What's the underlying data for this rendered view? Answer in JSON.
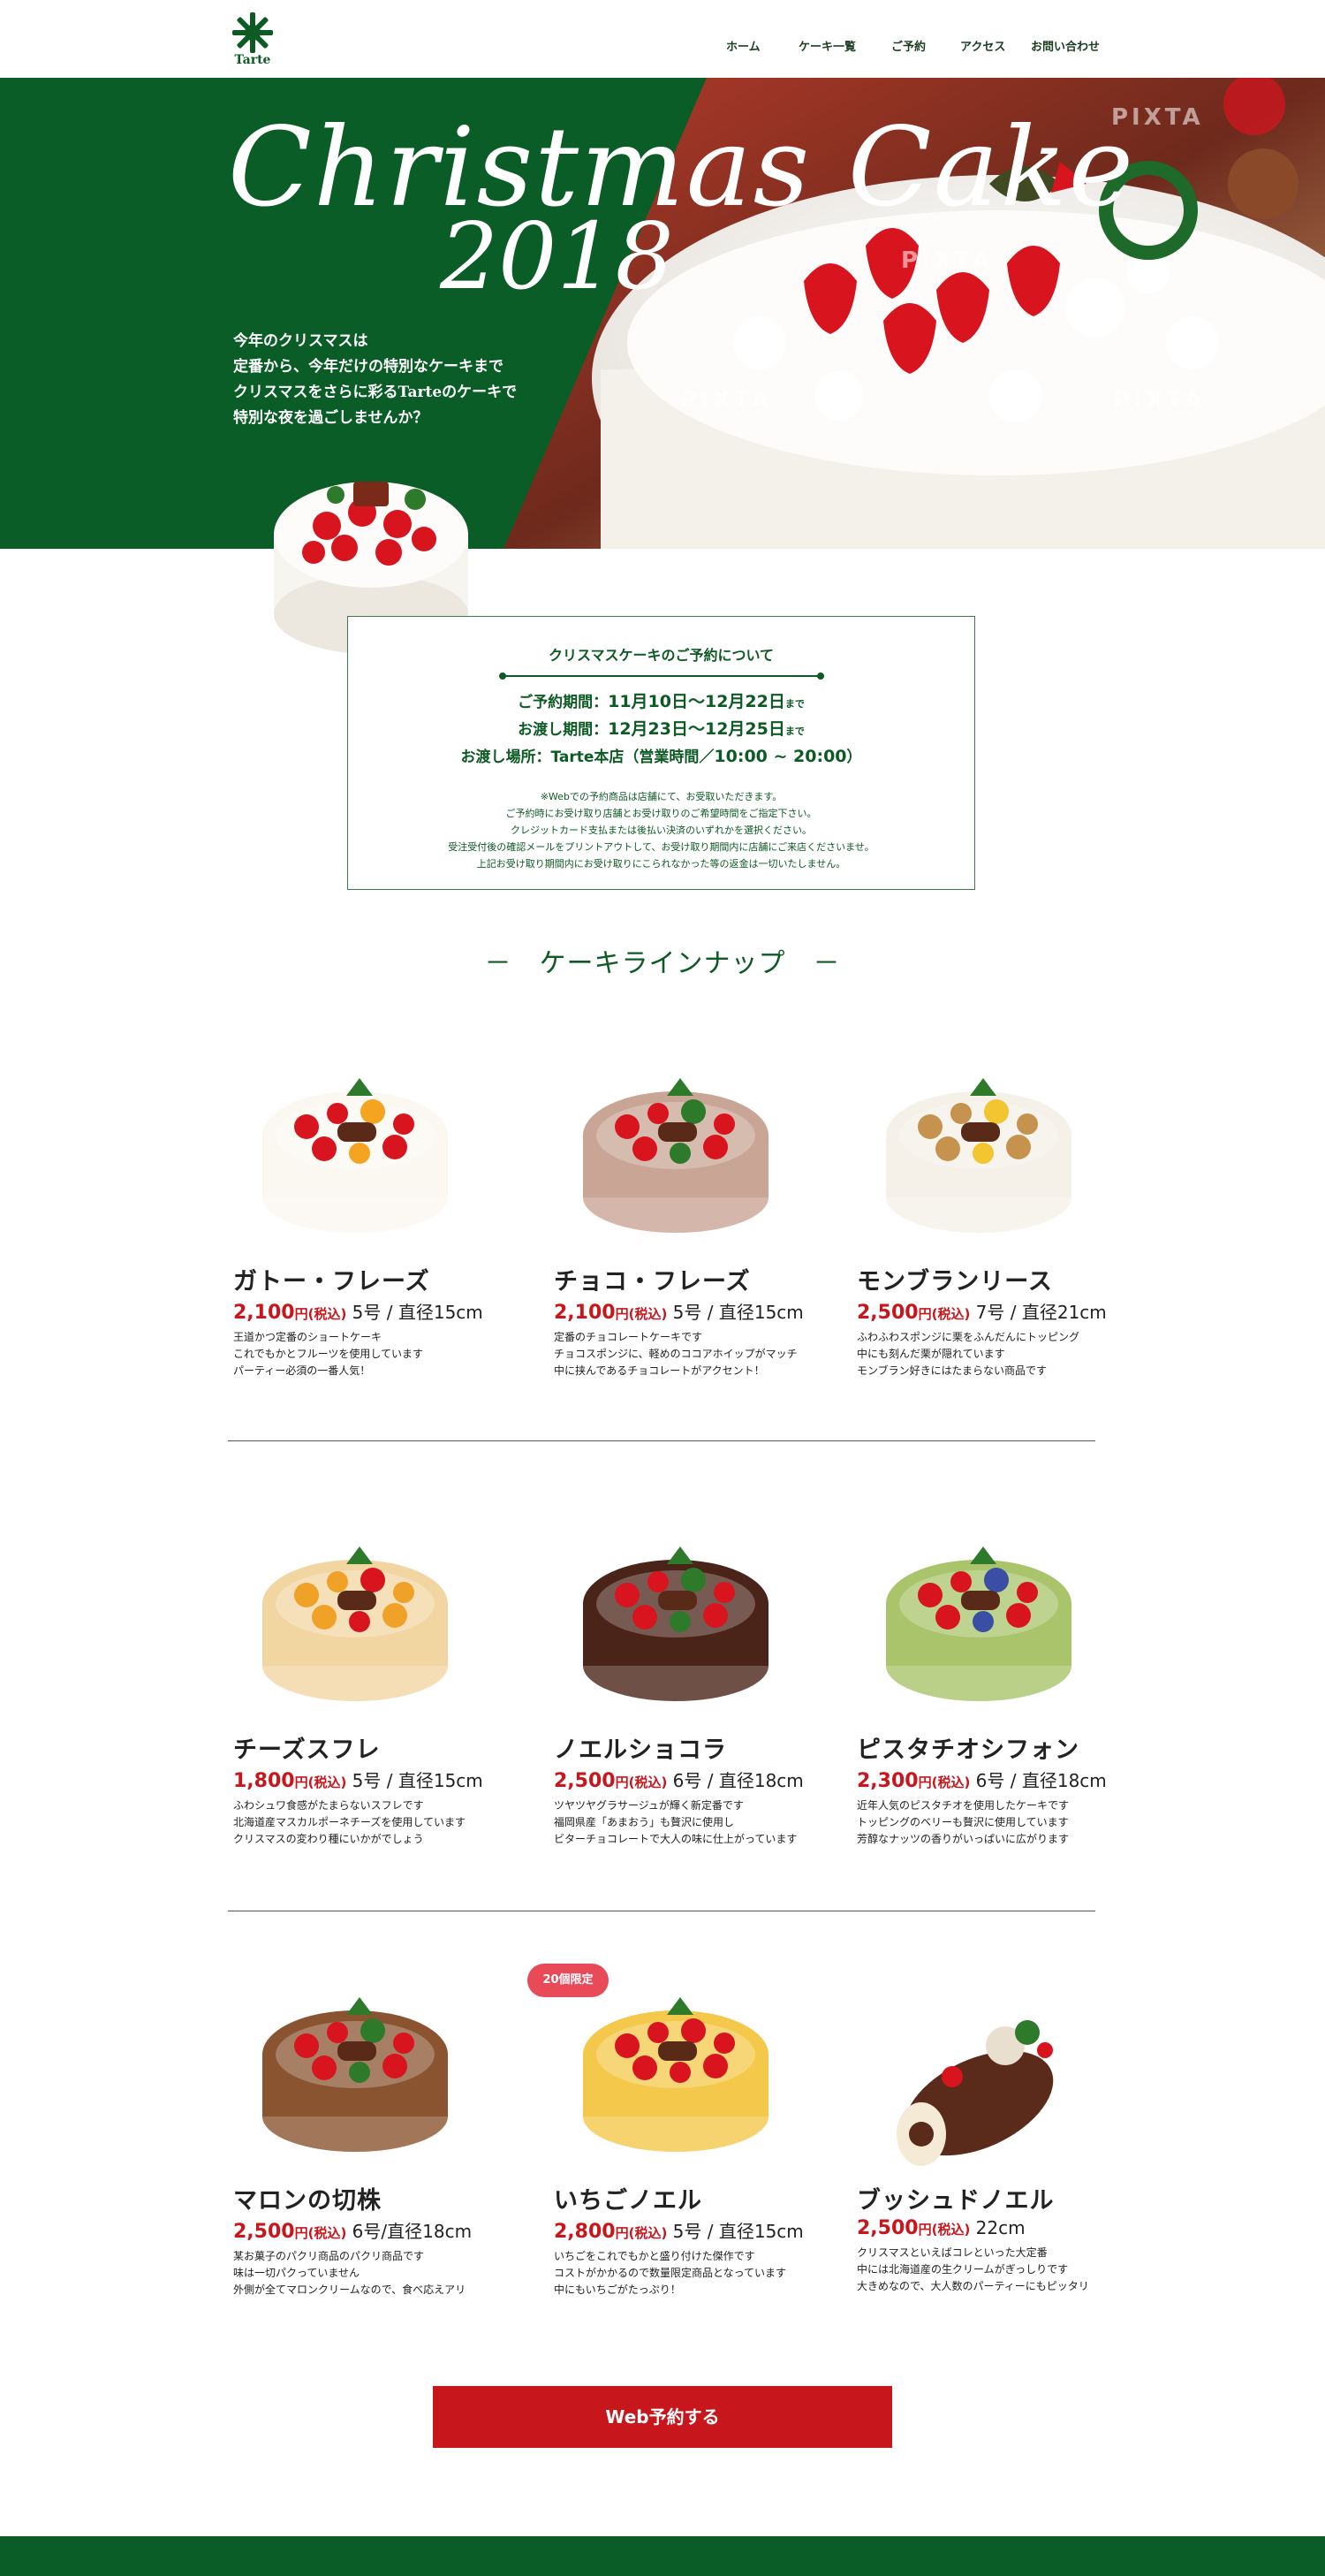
{
  "header": {
    "logo_text": "Tarte",
    "nav": [
      {
        "label": "ホーム"
      },
      {
        "label": "ケーキ一覧"
      },
      {
        "label": "ご予約"
      },
      {
        "label": "アクセス"
      },
      {
        "label": "お問い合わせ"
      }
    ]
  },
  "hero": {
    "title": "Christmas Cake",
    "year": "2018",
    "lead": [
      "今年のクリスマスは",
      "定番から、今年だけの特別なケーキまで",
      "クリスマスをさらに彩るTarteのケーキで",
      "特別な夜を過ごしませんか？"
    ],
    "watermark": "PIXTA"
  },
  "reservation": {
    "title": "クリスマスケーキのご予約について",
    "rows": [
      {
        "label": "ご予約期間：",
        "value": "11月10日～12月22日",
        "suffix": "まで"
      },
      {
        "label": "お渡し期間：",
        "value": "12月23日～12月25日",
        "suffix": "まで"
      },
      {
        "label": "お渡し場所：Tarte本店（営業時間／",
        "value": "10:00 ~ 20:00",
        "suffix": "）"
      }
    ],
    "notes": [
      "※Webでの予約商品は店舗にて、お受取いただきます。",
      "ご予約時にお受け取り店舗とお受け取りのご希望時間をご指定下さい。",
      "クレジットカード支払または後払い決済のいずれかを選択ください。",
      "受注受付後の確認メールをプリントアウトして、お受け取り期間内に店舗にご来店くださいませ。",
      "上記お受け取り期間内にお受け取りにこられなかった等の返金は一切いたしません。"
    ]
  },
  "lineup": {
    "heading": "－　ケーキラインナップ　－",
    "tax_label": "円(税込)",
    "cakes": [
      {
        "name": "ガトー・フレーズ",
        "price": "2,100",
        "size": "5号 / 直径15cm",
        "desc": [
          "王道かつ定番のショートケーキ",
          "これでもかとフルーツを使用しています",
          "パーティー必須の一番人気！"
        ],
        "cream": "#fbf8f2",
        "accent": "#d8141f",
        "fruit2": "#f5a421"
      },
      {
        "name": "チョコ・フレーズ",
        "price": "2,100",
        "size": "5号 / 直径15cm",
        "desc": [
          "定番のチョコレートケーキです",
          "チョコスポンジに、軽めのココアホイップがマッチ",
          "中に挟んであるチョコレートがアクセント！"
        ],
        "cream": "#c9a595",
        "accent": "#d8141f",
        "fruit2": "#2d7a2a"
      },
      {
        "name": "モンブランリース",
        "price": "2,500",
        "size": "7号 / 直径21cm",
        "desc": [
          "ふわふわスポンジに栗をふんだんにトッピング",
          "中にも刻んだ栗が隠れています",
          "モンブラン好きにはたまらない商品です"
        ],
        "cream": "#f5f1e8",
        "accent": "#c5934d",
        "fruit2": "#f2c531"
      },
      {
        "name": "チーズスフレ",
        "price": "1,800",
        "size": "5号 / 直径15cm",
        "desc": [
          "ふわシュワ食感がたまらないスフレです",
          "北海道産マスカルポーネチーズを使用しています",
          "クリスマスの変わり種にいかがでしょう"
        ],
        "cream": "#f2d6a2",
        "accent": "#f0a128",
        "fruit2": "#d8141f"
      },
      {
        "name": "ノエルショコラ",
        "price": "2,500",
        "size": "6号 / 直径18cm",
        "desc": [
          "ツヤツヤグラサージュが輝く新定番です",
          "福岡県産「あまおう」も贅沢に使用し",
          "ビターチョコレートで大人の味に仕上がっています"
        ],
        "cream": "#4a2419",
        "accent": "#d8141f",
        "fruit2": "#2d7a2a"
      },
      {
        "name": "ピスタチオシフォン",
        "price": "2,300",
        "size": "6号 / 直径18cm",
        "desc": [
          "近年人気のピスタチオを使用したケーキです",
          "トッピングのベリーも贅沢に使用しています",
          "芳醇なナッツの香りがいっぱいに広がります"
        ],
        "cream": "#a9c46a",
        "accent": "#d8141f",
        "fruit2": "#3a4ea3"
      },
      {
        "name": "マロンの切株",
        "price": "2,500",
        "size": "6号/直径18cm",
        "desc": [
          "某お菓子のパクリ商品のパクリ商品です",
          "味は一切パクっていません",
          "外側が全てマロンクリームなので、食べ応えアリ"
        ],
        "cream": "#8a5430",
        "accent": "#d8141f",
        "fruit2": "#2d7a2a"
      },
      {
        "name": "いちごノエル",
        "price": "2,800",
        "size": "5号 / 直径15cm",
        "desc": [
          "いちごをこれでもかと盛り付けた傑作です",
          "コストがかかるので数量限定商品となっています",
          "中にもいちごがたっぷり！"
        ],
        "cream": "#f4c84a",
        "accent": "#d8141f",
        "fruit2": "#d8141f"
      },
      {
        "name": "ブッシュドノエル",
        "price": "2,500",
        "size": "22cm",
        "desc": [
          "クリスマスといえばコレといった大定番",
          "中には北海道産の生クリームがぎっしりです",
          "大きめなので、大人数のパーティーにもピッタリ"
        ],
        "cream": "#5a2a1a",
        "accent": "#d8141f",
        "fruit2": "#2d7a2a"
      }
    ],
    "limited_badge": "20個限定"
  },
  "cta": {
    "label": "Web予約する"
  },
  "colors": {
    "brand_green": "#0a5d27",
    "accent_red": "#c8161d",
    "badge_pink": "#e94a58"
  }
}
